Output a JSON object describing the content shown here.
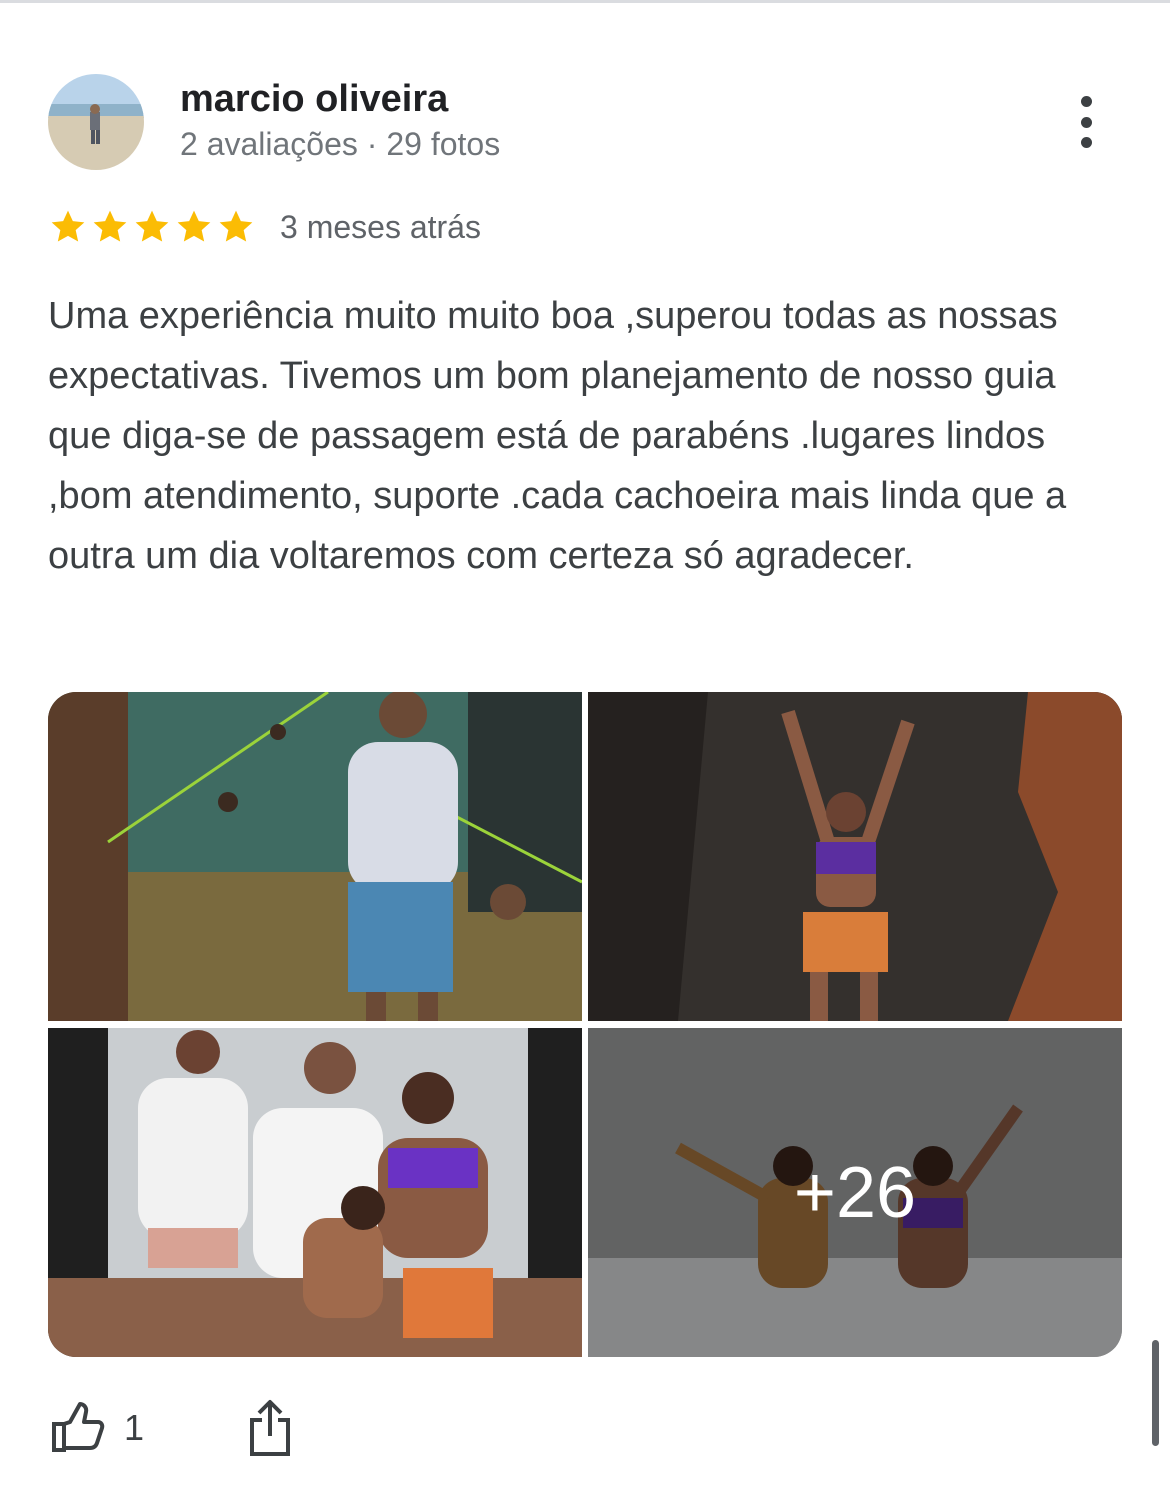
{
  "review": {
    "author": {
      "name": "marcio oliveira",
      "meta": "2 avaliações · 29 fotos",
      "avatar_icon": "profile-photo-beach"
    },
    "rating": {
      "stars": 5,
      "max_stars": 5,
      "star_color": "#fbbc04"
    },
    "time": "3 meses atrás",
    "text": "Uma experiência muito muito boa ,superou todas as nossas expectativas. Tivemos um bom planejamento de nosso guia que diga-se de passagem está de parabéns .lugares lindos ,bom atendimento, suporte .cada cachoeira mais linda que a outra um dia voltaremos com certeza só agradecer.",
    "photos": {
      "items": [
        {
          "icon": "photo-river-swimmers"
        },
        {
          "icon": "photo-waterfall-woman-arms-up"
        },
        {
          "icon": "photo-family-at-waterfall"
        },
        {
          "icon": "photo-women-in-waterfall"
        }
      ],
      "more_count": "+26"
    },
    "actions": {
      "like_count": "1",
      "like_icon": "thumb-up-icon",
      "share_icon": "share-icon",
      "more_icon": "more-vert-icon"
    }
  },
  "colors": {
    "text_primary": "#202124",
    "text_secondary": "#70757a",
    "star": "#fbbc04",
    "icon": "#3c4043"
  }
}
